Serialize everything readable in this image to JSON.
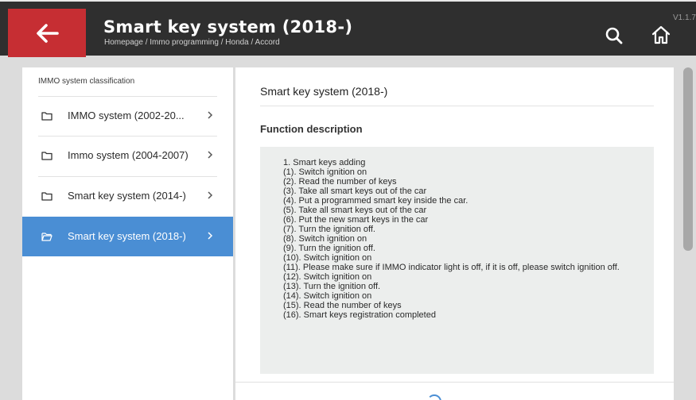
{
  "header": {
    "title": "Smart key system (2018-)",
    "breadcrumb": "Homepage / Immo programming / Honda / Accord",
    "version": "V1.1.7",
    "back_icon": "arrow-left-icon",
    "search_icon": "search-icon",
    "home_icon": "home-icon",
    "accent_color": "#c62e33"
  },
  "sidebar": {
    "heading": "IMMO system classification",
    "items": [
      {
        "label": "IMMO system (2002-20...",
        "icon": "folder-icon",
        "active": false
      },
      {
        "label": "Immo system (2004-2007)",
        "icon": "folder-icon",
        "active": false
      },
      {
        "label": "Smart key system (2014-)",
        "icon": "folder-icon",
        "active": false
      },
      {
        "label": "Smart key system (2018-)",
        "icon": "folder-open-icon",
        "active": true
      }
    ],
    "active_color": "#4a8ed4"
  },
  "content": {
    "title": "Smart key system (2018-)",
    "section_heading": "Function description",
    "description_lines": [
      "1. Smart keys adding",
      "(1). Switch ignition on",
      "(2). Read the number of keys",
      "(3). Take all smart keys out of the car",
      "(4). Put a programmed smart key inside the car.",
      "(5). Take all smart keys out of the car",
      "(6). Put the new smart keys in the car",
      "(7). Turn the ignition off.",
      "(8). Switch ignition on",
      "(9). Turn the ignition off.",
      "(10). Switch ignition on",
      "(11). Please make sure if IMMO indicator light is off, if it is off, please switch ignition off.",
      "(12). Switch ignition on",
      "(13). Turn the ignition off.",
      "(14). Switch ignition on",
      "(15). Read the number of keys",
      "(16). Smart keys registration completed"
    ]
  }
}
